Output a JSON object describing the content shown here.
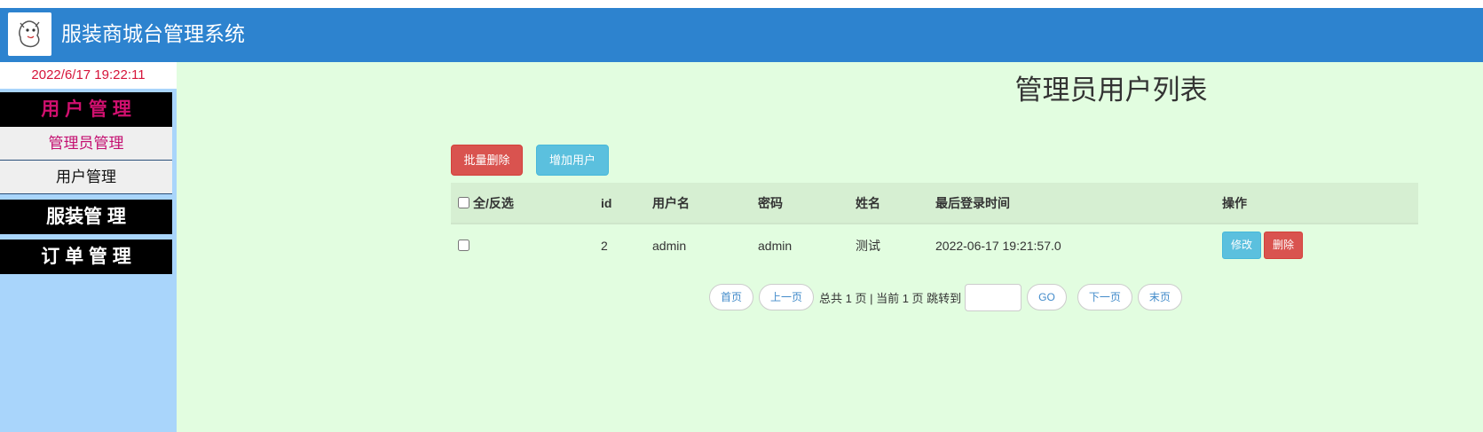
{
  "app": {
    "title": "服装商城台管理系统"
  },
  "sidebar": {
    "clock": "2022/6/17 19:22:11",
    "sections": [
      {
        "label": "用 户 管 理",
        "items": [
          "管理员管理",
          "用户管理"
        ]
      },
      {
        "label": "服装管 理"
      },
      {
        "label": "订 单 管 理"
      }
    ]
  },
  "main": {
    "title": "管理员用户列表",
    "batch_delete": "批量删除",
    "add_user": "增加用户",
    "table": {
      "headers": [
        "全/反选",
        "id",
        "用户名",
        "密码",
        "姓名",
        "最后登录时间",
        "操作"
      ],
      "rows": [
        {
          "id": "2",
          "username": "admin",
          "password": "admin",
          "name": "测试",
          "last_login": "2022-06-17 19:21:57.0",
          "edit": "修改",
          "delete": "删除"
        }
      ]
    },
    "pager": {
      "first": "首页",
      "prev": "上一页",
      "info": "总共 1 页 | 当前 1 页 跳转到",
      "go": "GO",
      "next": "下一页",
      "last": "末页"
    }
  },
  "colors": {
    "header": "#2d83cf",
    "sidebar": "#a9d5fb",
    "main_bg": "#e2fde0",
    "section_active": "#d1106f",
    "clock": "#d6143a",
    "danger": "#d9534f",
    "info": "#5bc0de"
  }
}
